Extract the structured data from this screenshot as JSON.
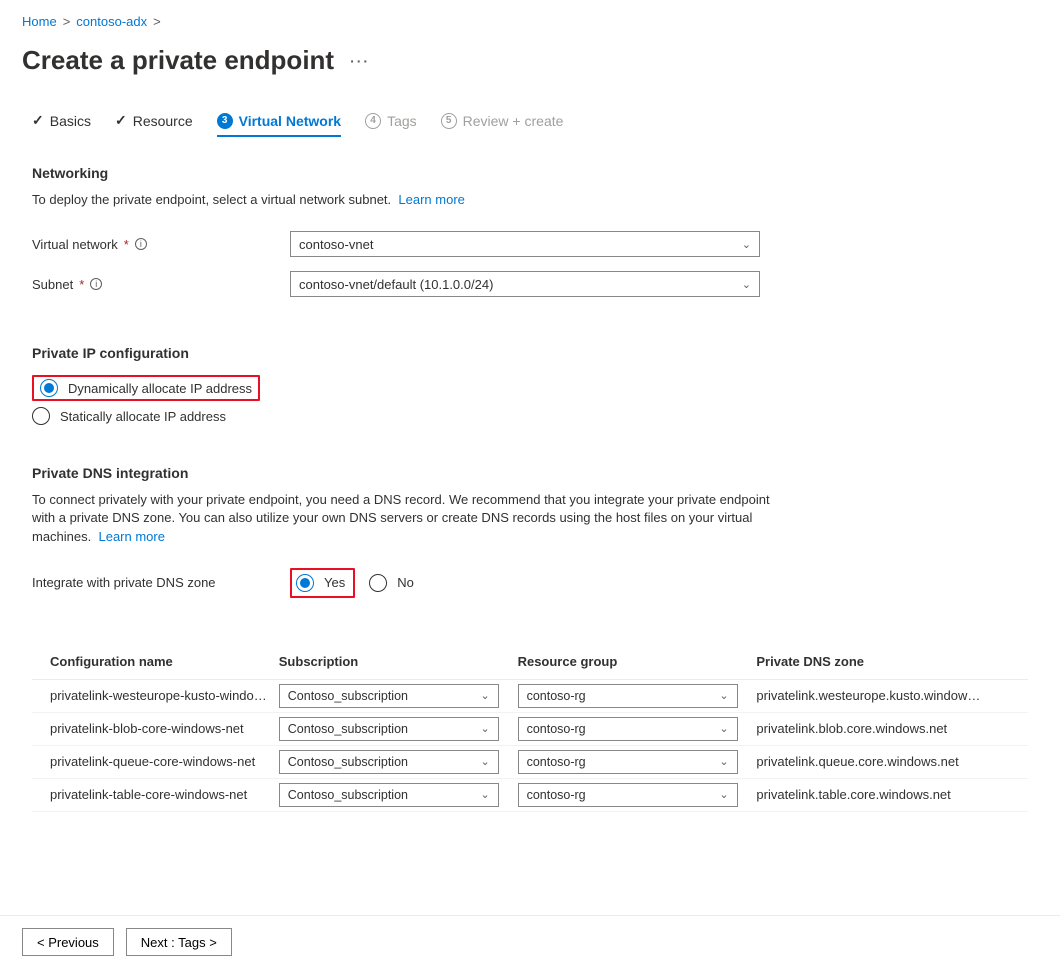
{
  "breadcrumb": {
    "home": "Home",
    "cluster": "contoso-adx"
  },
  "page_title": "Create a private endpoint",
  "tabs": {
    "basics": "Basics",
    "resource": "Resource",
    "vnet": "Virtual Network",
    "tags": "Tags",
    "review": "Review + create"
  },
  "networking": {
    "heading": "Networking",
    "desc": "To deploy the private endpoint, select a virtual network subnet.",
    "learn_more": "Learn more",
    "vnet_label": "Virtual network",
    "vnet_value": "contoso-vnet",
    "subnet_label": "Subnet",
    "subnet_value": "contoso-vnet/default (10.1.0.0/24)"
  },
  "ipconfig": {
    "heading": "Private IP configuration",
    "dynamic": "Dynamically allocate IP address",
    "static": "Statically allocate IP address"
  },
  "dns": {
    "heading": "Private DNS integration",
    "desc": "To connect privately with your private endpoint, you need a DNS record. We recommend that you integrate your private endpoint with a private DNS zone. You can also utilize your own DNS servers or create DNS records using the host files on your virtual machines.",
    "learn_more": "Learn more",
    "integrate_label": "Integrate with private DNS zone",
    "yes": "Yes",
    "no": "No",
    "cols": {
      "name": "Configuration name",
      "sub": "Subscription",
      "rg": "Resource group",
      "zone": "Private DNS zone"
    },
    "rows": [
      {
        "name": "privatelink-westeurope-kusto-windo…",
        "sub": "Contoso_subscription",
        "rg": "contoso-rg",
        "zone": "privatelink.westeurope.kusto.window…"
      },
      {
        "name": "privatelink-blob-core-windows-net",
        "sub": "Contoso_subscription",
        "rg": "contoso-rg",
        "zone": "privatelink.blob.core.windows.net"
      },
      {
        "name": "privatelink-queue-core-windows-net",
        "sub": "Contoso_subscription",
        "rg": "contoso-rg",
        "zone": "privatelink.queue.core.windows.net"
      },
      {
        "name": "privatelink-table-core-windows-net",
        "sub": "Contoso_subscription",
        "rg": "contoso-rg",
        "zone": "privatelink.table.core.windows.net"
      }
    ]
  },
  "footer": {
    "prev": "< Previous",
    "next": "Next : Tags >"
  }
}
